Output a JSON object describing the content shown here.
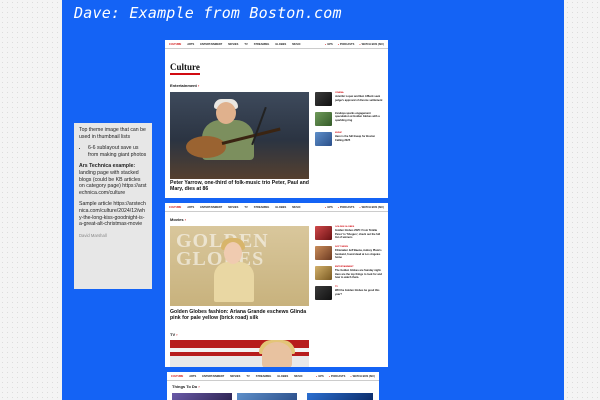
{
  "board": {
    "title": "Dave: Example from Boston.com",
    "bg_color": "#1463f5"
  },
  "note": {
    "intro": "Top theme image that can be used in thumbnail lists",
    "bullet": "6-6 sublayout save us from making giant photos",
    "ars_heading": "Ars Technica example:",
    "ars_text": "landing page with stacked blogs (could be KB articles on category page)",
    "ars_url": "https://arstechnica.com/culture",
    "sample_label": "Sample article",
    "sample_url": "https://arstechnica.com/culture/2024/12/why-the-long-kiss-goodnight-is-a-great-alt-christmas-movie",
    "author": "David Marshall"
  },
  "nav": {
    "items": [
      "CULTURE",
      "ARTS",
      "ENTERTAINMENT",
      "MOVIES",
      "TV",
      "STREAMING",
      "GLOBES",
      "MUSIC"
    ],
    "right": [
      "GPS",
      "PODCASTS",
      "WATCH BOS (SIC)"
    ]
  },
  "shot1": {
    "section_title": "Culture",
    "subhead": "Entertainment",
    "hero_caption": "Peter Yarrow, one-third of folk-music trio Peter, Paul and Mary, dies at 86",
    "side": [
      {
        "tag": "CINEMA",
        "text": "Jennifer Lopez and Ben Affleck seek judge's approval of divorce settlement"
      },
      {
        "tag": "",
        "text": "Zendaya sparks engagement speculation at Golden Globes with a sparkling ring"
      },
      {
        "tag": "MUSIC",
        "text": "Here is the full lineup for Boston Calling 2025"
      }
    ]
  },
  "shot2": {
    "subhead": "Movies",
    "hero_caption": "Golden Globes fashion: Ariana Grande eschews Glinda pink for pale yellow (brick road) silk",
    "tv_subhead": "TV",
    "side": [
      {
        "tag": "GOLDEN GLOBES",
        "text": "Golden Globes 2025: From 'Emilia Perez' to 'Shogun,' check out the full list of winners"
      },
      {
        "tag": "SOFT NEWS",
        "text": "Filmmaker Jeff Baena, Aubrey Plaza's husband, found dead at Los Angeles home"
      },
      {
        "tag": "ENTERTAINMENT",
        "text": "The Golden Globes are Sunday night. Here are the top things to look for and how to watch them."
      },
      {
        "tag": "TV",
        "text": "Will the Golden Globes be good this year?"
      }
    ]
  },
  "shot3": {
    "subhead": "Things To Do"
  }
}
